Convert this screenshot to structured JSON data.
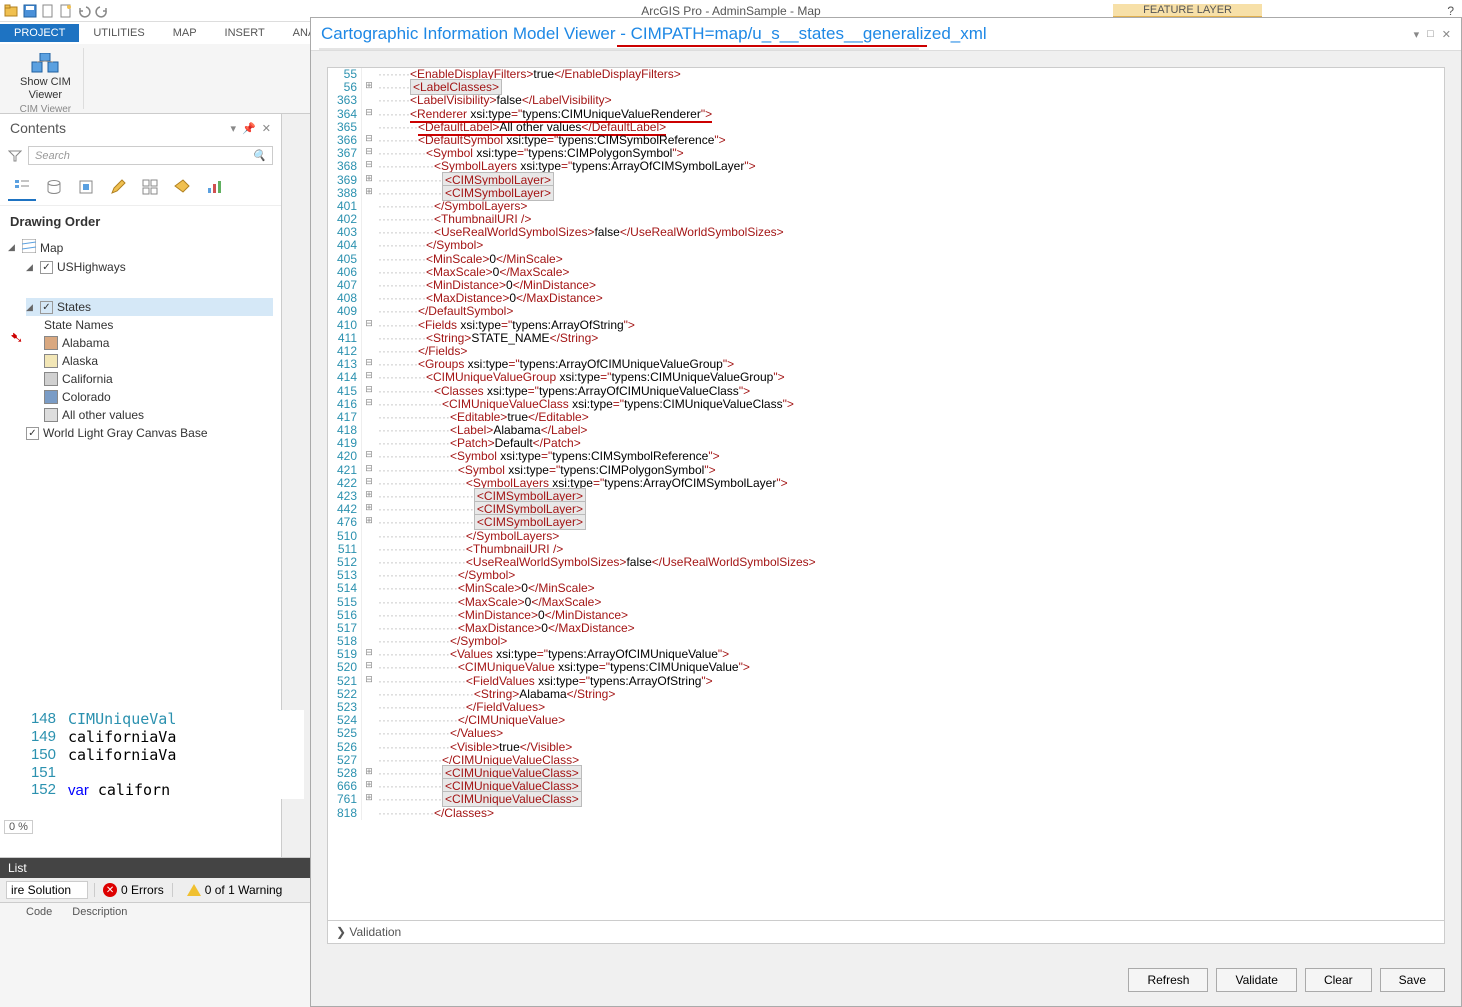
{
  "app": {
    "title": "ArcGIS Pro - AdminSample - Map",
    "context_tab": "FEATURE LAYER",
    "help": "?"
  },
  "ribbon": {
    "tabs": [
      "PROJECT",
      "UTILITIES",
      "MAP",
      "INSERT",
      "ANALYS"
    ],
    "active": "PROJECT",
    "cim_btn_l1": "Show CIM",
    "cim_btn_l2": "Viewer",
    "group": "CIM Viewer"
  },
  "contents": {
    "title": "Contents",
    "search_placeholder": "Search",
    "heading": "Drawing Order",
    "map": "Map",
    "layers": {
      "ushighways": "USHighways",
      "states": "States",
      "state_names_hdr": "State Names",
      "all_other": "All other values",
      "basemap": "World Light Gray Canvas Base",
      "items": [
        {
          "label": "Alabama",
          "color": "#d9a880"
        },
        {
          "label": "Alaska",
          "color": "#f2e6b6"
        },
        {
          "label": "California",
          "color": "#d0d0d0"
        },
        {
          "label": "Colorado",
          "color": "#7a9cc6"
        }
      ]
    }
  },
  "cim": {
    "title": "Cartographic Information Model Viewer - CIMPATH=map/u_s__states__generalized_xml",
    "validation": "Validation",
    "buttons": {
      "refresh": "Refresh",
      "validate": "Validate",
      "clear": "Clear",
      "save": "Save"
    },
    "xml_lines": [
      {
        "n": 55,
        "f": "",
        "pre": "        ",
        "raw": "<EnableDisplayFilters>|true|</EnableDisplayFilters>"
      },
      {
        "n": 56,
        "f": "+",
        "pre": "        ",
        "hl": 1,
        "raw": "<LabelClasses>"
      },
      {
        "n": 363,
        "f": "",
        "pre": "        ",
        "raw": "<LabelVisibility>|false|</LabelVisibility>"
      },
      {
        "n": 364,
        "f": "-",
        "pre": "        ",
        "ru": 1,
        "raw": "<Renderer |xsi:||type|=\"|typens:CIMUniqueValueRenderer|\">"
      },
      {
        "n": 365,
        "f": "",
        "pre": "          ",
        "ru": 1,
        "raw": "<DefaultLabel>|All other values|</DefaultLabel>"
      },
      {
        "n": 366,
        "f": "-",
        "pre": "          ",
        "raw": "<DefaultSymbol |xsi:||type|=\"|typens:CIMSymbolReference|\">"
      },
      {
        "n": 367,
        "f": "-",
        "pre": "            ",
        "raw": "<Symbol |xsi:||type|=\"|typens:CIMPolygonSymbol|\">"
      },
      {
        "n": 368,
        "f": "-",
        "pre": "              ",
        "raw": "<SymbolLayers |xsi:||type|=\"|typens:ArrayOfCIMSymbolLayer|\">"
      },
      {
        "n": 369,
        "f": "+",
        "pre": "                ",
        "hl": 1,
        "raw": "<CIMSymbolLayer>"
      },
      {
        "n": 388,
        "f": "+",
        "pre": "                ",
        "hl": 1,
        "raw": "<CIMSymbolLayer>"
      },
      {
        "n": 401,
        "f": "",
        "pre": "              ",
        "raw": "</SymbolLayers>"
      },
      {
        "n": 402,
        "f": "",
        "pre": "              ",
        "raw": "<ThumbnailURI />"
      },
      {
        "n": 403,
        "f": "",
        "pre": "              ",
        "raw": "<UseRealWorldSymbolSizes>|false|</UseRealWorldSymbolSizes>"
      },
      {
        "n": 404,
        "f": "",
        "pre": "            ",
        "raw": "</Symbol>"
      },
      {
        "n": 405,
        "f": "",
        "pre": "            ",
        "raw": "<MinScale>|0|</MinScale>"
      },
      {
        "n": 406,
        "f": "",
        "pre": "            ",
        "raw": "<MaxScale>|0|</MaxScale>"
      },
      {
        "n": 407,
        "f": "",
        "pre": "            ",
        "raw": "<MinDistance>|0|</MinDistance>"
      },
      {
        "n": 408,
        "f": "",
        "pre": "            ",
        "raw": "<MaxDistance>|0|</MaxDistance>"
      },
      {
        "n": 409,
        "f": "",
        "pre": "          ",
        "raw": "</DefaultSymbol>"
      },
      {
        "n": 410,
        "f": "-",
        "pre": "          ",
        "raw": "<Fields |xsi:||type|=\"|typens:ArrayOfString|\">"
      },
      {
        "n": 411,
        "f": "",
        "pre": "            ",
        "raw": "<String>|STATE_NAME|</String>"
      },
      {
        "n": 412,
        "f": "",
        "pre": "          ",
        "raw": "</Fields>"
      },
      {
        "n": 413,
        "f": "-",
        "pre": "          ",
        "raw": "<Groups |xsi:||type|=\"|typens:ArrayOfCIMUniqueValueGroup|\">"
      },
      {
        "n": 414,
        "f": "-",
        "pre": "            ",
        "raw": "<CIMUniqueValueGroup |xsi:||type|=\"|typens:CIMUniqueValueGroup|\">"
      },
      {
        "n": 415,
        "f": "-",
        "pre": "              ",
        "raw": "<Classes |xsi:||type|=\"|typens:ArrayOfCIMUniqueValueClass|\">"
      },
      {
        "n": 416,
        "f": "-",
        "pre": "                ",
        "raw": "<CIMUniqueValueClass |xsi:||type|=\"|typens:CIMUniqueValueClass|\">"
      },
      {
        "n": 417,
        "f": "",
        "pre": "                  ",
        "raw": "<Editable>|true|</Editable>"
      },
      {
        "n": 418,
        "f": "",
        "pre": "                  ",
        "raw": "<Label>|Alabama|</Label>"
      },
      {
        "n": 419,
        "f": "",
        "pre": "                  ",
        "raw": "<Patch>|Default|</Patch>"
      },
      {
        "n": 420,
        "f": "-",
        "pre": "                  ",
        "raw": "<Symbol |xsi:||type|=\"|typens:CIMSymbolReference|\">"
      },
      {
        "n": 421,
        "f": "-",
        "pre": "                    ",
        "raw": "<Symbol |xsi:||type|=\"|typens:CIMPolygonSymbol|\">"
      },
      {
        "n": 422,
        "f": "-",
        "pre": "                      ",
        "raw": "<SymbolLayers |xsi:||type|=\"|typens:ArrayOfCIMSymbolLayer|\">"
      },
      {
        "n": 423,
        "f": "+",
        "pre": "                        ",
        "hl": 1,
        "raw": "<CIMSymbolLayer>"
      },
      {
        "n": 442,
        "f": "+",
        "pre": "                        ",
        "hl": 1,
        "raw": "<CIMSymbolLayer>"
      },
      {
        "n": 476,
        "f": "+",
        "pre": "                        ",
        "hl": 1,
        "raw": "<CIMSymbolLayer>"
      },
      {
        "n": 510,
        "f": "",
        "pre": "                      ",
        "raw": "</SymbolLayers>"
      },
      {
        "n": 511,
        "f": "",
        "pre": "                      ",
        "raw": "<ThumbnailURI />"
      },
      {
        "n": 512,
        "f": "",
        "pre": "                      ",
        "raw": "<UseRealWorldSymbolSizes>|false|</UseRealWorldSymbolSizes>"
      },
      {
        "n": 513,
        "f": "",
        "pre": "                    ",
        "raw": "</Symbol>"
      },
      {
        "n": 514,
        "f": "",
        "pre": "                    ",
        "raw": "<MinScale>|0|</MinScale>"
      },
      {
        "n": 515,
        "f": "",
        "pre": "                    ",
        "raw": "<MaxScale>|0|</MaxScale>"
      },
      {
        "n": 516,
        "f": "",
        "pre": "                    ",
        "raw": "<MinDistance>|0|</MinDistance>"
      },
      {
        "n": 517,
        "f": "",
        "pre": "                    ",
        "raw": "<MaxDistance>|0|</MaxDistance>"
      },
      {
        "n": 518,
        "f": "",
        "pre": "                  ",
        "raw": "</Symbol>"
      },
      {
        "n": 519,
        "f": "-",
        "pre": "                  ",
        "raw": "<Values |xsi:||type|=\"|typens:ArrayOfCIMUniqueValue|\">"
      },
      {
        "n": 520,
        "f": "-",
        "pre": "                    ",
        "raw": "<CIMUniqueValue |xsi:||type|=\"|typens:CIMUniqueValue|\">"
      },
      {
        "n": 521,
        "f": "-",
        "pre": "                      ",
        "raw": "<FieldValues |xsi:||type|=\"|typens:ArrayOfString|\">"
      },
      {
        "n": 522,
        "f": "",
        "pre": "                        ",
        "raw": "<String>|Alabama|</String>"
      },
      {
        "n": 523,
        "f": "",
        "pre": "                      ",
        "raw": "</FieldValues>"
      },
      {
        "n": 524,
        "f": "",
        "pre": "                    ",
        "raw": "</CIMUniqueValue>"
      },
      {
        "n": 525,
        "f": "",
        "pre": "                  ",
        "raw": "</Values>"
      },
      {
        "n": 526,
        "f": "",
        "pre": "                  ",
        "raw": "<Visible>|true|</Visible>"
      },
      {
        "n": 527,
        "f": "",
        "pre": "                ",
        "raw": "</CIMUniqueValueClass>"
      },
      {
        "n": 528,
        "f": "+",
        "pre": "                ",
        "hl": 1,
        "raw": "<CIMUniqueValueClass>"
      },
      {
        "n": 666,
        "f": "+",
        "pre": "                ",
        "hl": 1,
        "raw": "<CIMUniqueValueClass>"
      },
      {
        "n": 761,
        "f": "+",
        "pre": "                ",
        "hl": 1,
        "raw": "<CIMUniqueValueClass>"
      },
      {
        "n": 818,
        "f": "",
        "pre": "              ",
        "raw": "</Classes>"
      }
    ]
  },
  "bottom_code": {
    "lines": [
      {
        "n": 148,
        "t": "CIMUniqueVal",
        "cls": "t"
      },
      {
        "n": 149,
        "t": "californiaVa",
        "cls": ""
      },
      {
        "n": 150,
        "t": "californiaVa",
        "cls": ""
      },
      {
        "n": 151,
        "t": "",
        "cls": ""
      },
      {
        "n": 152,
        "t": "var californ",
        "cls": "k"
      }
    ],
    "pct": "0 %"
  },
  "errorlist": {
    "title": "List",
    "scope": "ire Solution",
    "errors": "0 Errors",
    "warnings": "0 of 1 Warning",
    "cols": [
      "",
      "Code",
      "Description"
    ]
  }
}
